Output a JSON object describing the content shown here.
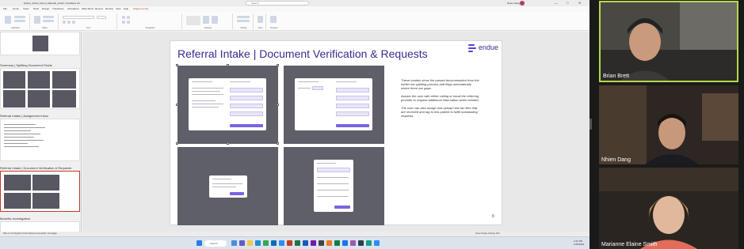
{
  "powerpoint": {
    "file_name": "Endue_Admin_Demo_Material_Jan22 • AutoSave On",
    "search_placeholder": "Search",
    "user_name": "Nhien Dang",
    "window_controls": [
      "—",
      "□",
      "✕"
    ],
    "menu": [
      "File",
      "Home",
      "Insert",
      "Draw",
      "Design",
      "Transitions",
      "Animations",
      "Slide Show",
      "Record",
      "Review",
      "View",
      "Help",
      "Shape Format"
    ],
    "active_menu": "Shape Format",
    "record_label": "Record",
    "present_label": "Present",
    "ribbon_groups": [
      "Clipboard",
      "Slides",
      "Font",
      "Paragraph",
      "Drawing",
      "Editing",
      "Voice",
      "Designer"
    ],
    "thumbnails": [
      {
        "title": "Summary | Splitting Document Fields"
      },
      {
        "title": "Referral Intake | Assignment Inbox"
      },
      {
        "title": "Referral Intake | Document Verification & Requests"
      },
      {
        "title": "Benefits Investigation"
      }
    ],
    "slide": {
      "title": "Referral Intake | Document Verification & Requests",
      "logo_text": "endue",
      "description": [
        "These modals show the parsed documentation from the earlier fax splitting process and flags automatically where there are gaps.",
        "Assists the user with either calling or email the referring provider to request additional information when needed.",
        "The user can also assign and upload new fax files that are received and tag to this patient to fulfill outstanding requests."
      ],
      "page_number": "8"
    },
    "status_left": "Slide 9 of 24   English (United States)   Accessibility: Investigate",
    "status_right": "Notes   Display Settings   90%",
    "taskbar_search": "Search",
    "clock": "2:41 PM",
    "date": "1/25/2022"
  },
  "participants": [
    {
      "name": "Brian Brett",
      "active_speaker": true
    },
    {
      "name": "Nhien Dang",
      "active_speaker": false
    },
    {
      "name": "Marianne Elaine Smith",
      "active_speaker": false
    }
  ],
  "colors": {
    "accent": "#3c2a8f",
    "modal_purple": "#7b63e0",
    "present_red": "#c0392b",
    "speaker_border": "#b7d84b"
  }
}
